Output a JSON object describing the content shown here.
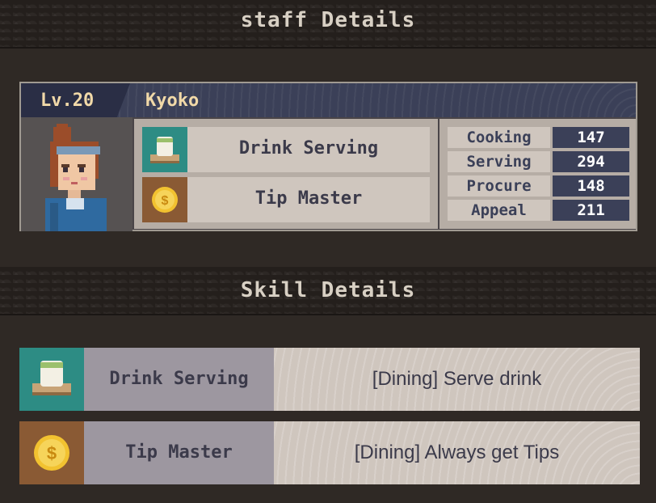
{
  "headers": {
    "staff_details": "staff Details",
    "skill_details": "Skill Details"
  },
  "staff": {
    "level": "Lv.20",
    "name": "Kyoko",
    "skills": [
      {
        "label": "Drink Serving",
        "icon": "tea-cup-icon"
      },
      {
        "label": "Tip Master",
        "icon": "gold-coin-icon"
      }
    ],
    "stats": [
      {
        "label": "Cooking",
        "value": "147"
      },
      {
        "label": "Serving",
        "value": "294"
      },
      {
        "label": "Procure",
        "value": "148"
      },
      {
        "label": "Appeal",
        "value": "211"
      }
    ]
  },
  "skill_details": [
    {
      "name": "Drink Serving",
      "desc": "[Dining] Serve drink",
      "icon": "tea-cup-icon"
    },
    {
      "name": "Tip Master",
      "desc": "[Dining] Always get Tips",
      "icon": "gold-coin-icon"
    }
  ],
  "colors": {
    "accent_navy": "#3b4058",
    "tea_bg": "#2d8c84",
    "tip_bg": "#8a5a34",
    "gold": "#f2c230"
  }
}
